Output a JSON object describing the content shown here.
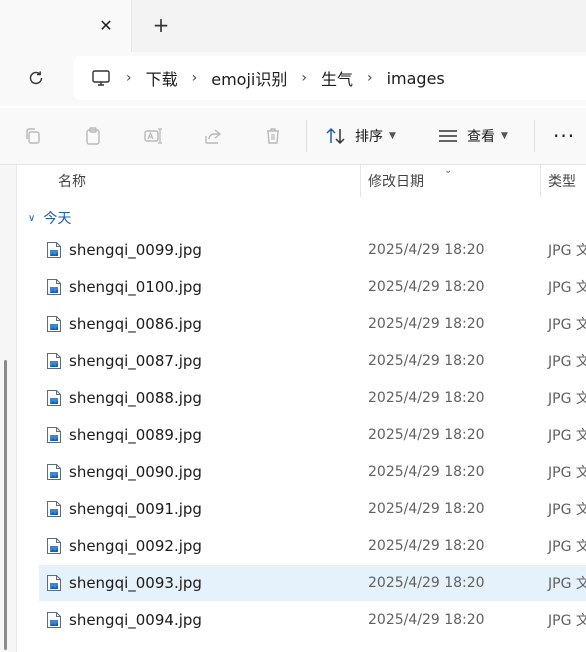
{
  "tabs": {
    "close_glyph": "✕",
    "new_tab_glyph": "+"
  },
  "address": {
    "breadcrumbs": [
      "下载",
      "emoji识别",
      "生气",
      "images"
    ],
    "separator": "›"
  },
  "toolbar": {
    "sort_label": "排序",
    "view_label": "查看",
    "more_label": "···"
  },
  "columns": {
    "name": "名称",
    "modified": "修改日期",
    "type": "类型"
  },
  "group": {
    "label": "今天"
  },
  "files": [
    {
      "name": "shengqi_0099.jpg",
      "date": "2025/4/29 18:20",
      "type": "JPG 文"
    },
    {
      "name": "shengqi_0100.jpg",
      "date": "2025/4/29 18:20",
      "type": "JPG 文"
    },
    {
      "name": "shengqi_0086.jpg",
      "date": "2025/4/29 18:20",
      "type": "JPG 文"
    },
    {
      "name": "shengqi_0087.jpg",
      "date": "2025/4/29 18:20",
      "type": "JPG 文"
    },
    {
      "name": "shengqi_0088.jpg",
      "date": "2025/4/29 18:20",
      "type": "JPG 文"
    },
    {
      "name": "shengqi_0089.jpg",
      "date": "2025/4/29 18:20",
      "type": "JPG 文"
    },
    {
      "name": "shengqi_0090.jpg",
      "date": "2025/4/29 18:20",
      "type": "JPG 文"
    },
    {
      "name": "shengqi_0091.jpg",
      "date": "2025/4/29 18:20",
      "type": "JPG 文"
    },
    {
      "name": "shengqi_0092.jpg",
      "date": "2025/4/29 18:20",
      "type": "JPG 文"
    },
    {
      "name": "shengqi_0093.jpg",
      "date": "2025/4/29 18:20",
      "type": "JPG 文",
      "selected": true
    },
    {
      "name": "shengqi_0094.jpg",
      "date": "2025/4/29 18:20",
      "type": "JPG 文"
    }
  ],
  "colors": {
    "accent": "#1f5fa8",
    "selection": "#e5f1fb"
  }
}
